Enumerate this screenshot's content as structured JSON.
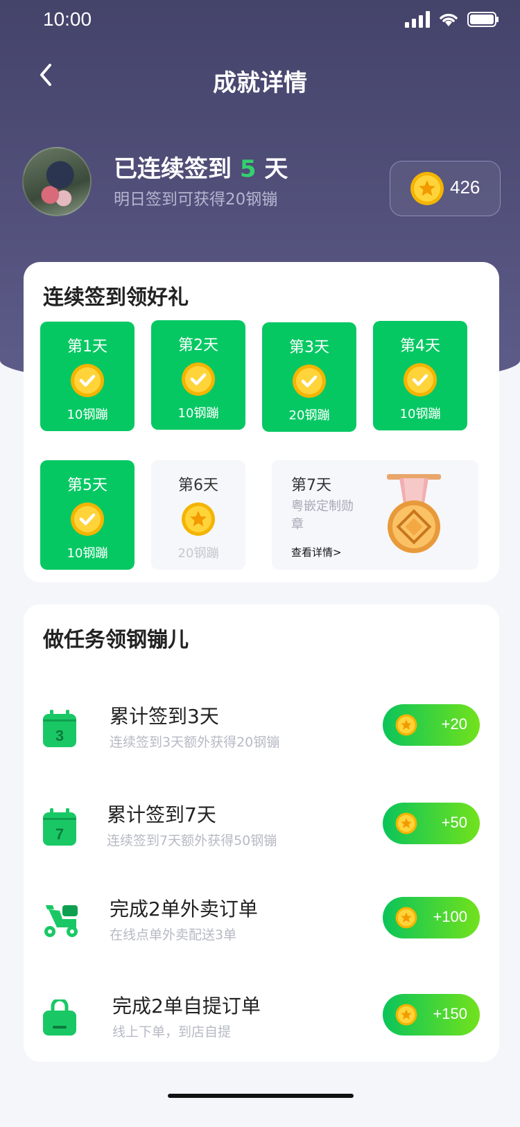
{
  "status_bar": {
    "time": "10:00"
  },
  "nav": {
    "title": "成就详情"
  },
  "profile": {
    "streak_prefix": "已连续签到",
    "streak_days": "5",
    "streak_suffix": "天",
    "tomorrow_tip": "明日签到可获得20钢镚",
    "coins": "426"
  },
  "checkin": {
    "title": "连续签到领好礼",
    "days": [
      {
        "label": "第1天",
        "reward": "10钢蹦",
        "done": true
      },
      {
        "label": "第2天",
        "reward": "10钢蹦",
        "done": true
      },
      {
        "label": "第3天",
        "reward": "20钢蹦",
        "done": true
      },
      {
        "label": "第4天",
        "reward": "10钢蹦",
        "done": true
      },
      {
        "label": "第5天",
        "reward": "10钢蹦",
        "done": true
      },
      {
        "label": "第6天",
        "reward": "20钢蹦",
        "done": false
      }
    ],
    "day7": {
      "label": "第7天",
      "desc": "粤嵌定制勋章",
      "link": "查看详情>"
    }
  },
  "tasks": {
    "title": "做任务领钢镚儿",
    "items": [
      {
        "title": "累计签到3天",
        "sub": "连续签到3天额外获得20钢镚",
        "reward": "+20",
        "icon": "calendar-3-icon"
      },
      {
        "title": "累计签到7天",
        "sub": "连续签到7天额外获得50钢镚",
        "reward": "+50",
        "icon": "calendar-7-icon"
      },
      {
        "title": "完成2单外卖订单",
        "sub": "在线点单外卖配送3单",
        "reward": "+100",
        "icon": "scooter-icon"
      },
      {
        "title": "完成2单自提订单",
        "sub": "线上下单，到店自提",
        "reward": "+150",
        "icon": "shopping-bag-icon"
      }
    ]
  },
  "colors": {
    "accent_green": "#06c863",
    "header": "#4a4971"
  }
}
